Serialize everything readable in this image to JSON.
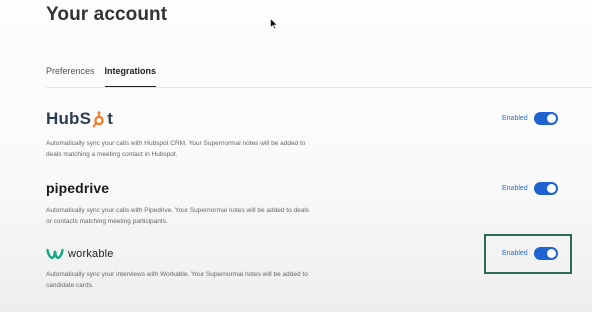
{
  "page": {
    "title": "Your account"
  },
  "tabs": [
    {
      "label": "Preferences",
      "active": false
    },
    {
      "label": "Integrations",
      "active": true
    }
  ],
  "integrations": [
    {
      "name": "HubSpot",
      "logo_text_left": "HubS",
      "logo_text_right": "t",
      "logo_icon": "hubspot-sprocket-icon",
      "description": "Automatically sync your calls with Hubspot CRM. Your Supernormal notes will be added to deals matching a meeting contact in Hubspot.",
      "status": "Enabled",
      "enabled": true
    },
    {
      "name": "pipedrive",
      "logo_text": "pipedrive",
      "description": "Automatically sync your calls with Pipedrive. Your Supernormal notes will be added to deals or contacts matching meeting participants.",
      "status": "Enabled",
      "enabled": true
    },
    {
      "name": "workable",
      "logo_text": "workable",
      "logo_icon": "workable-w-icon",
      "description": "Automatically sync your interviews with Workable. Your Supernormal notes will be added to candidate cards.",
      "status": "Enabled",
      "enabled": true,
      "highlighted": true
    }
  ],
  "colors": {
    "toggle_on": "#1f63d1",
    "status_text": "#2f6ec6",
    "highlight_border": "#2e6a5a",
    "hubspot_orange": "#f57722",
    "workable_green": "#14a884"
  }
}
